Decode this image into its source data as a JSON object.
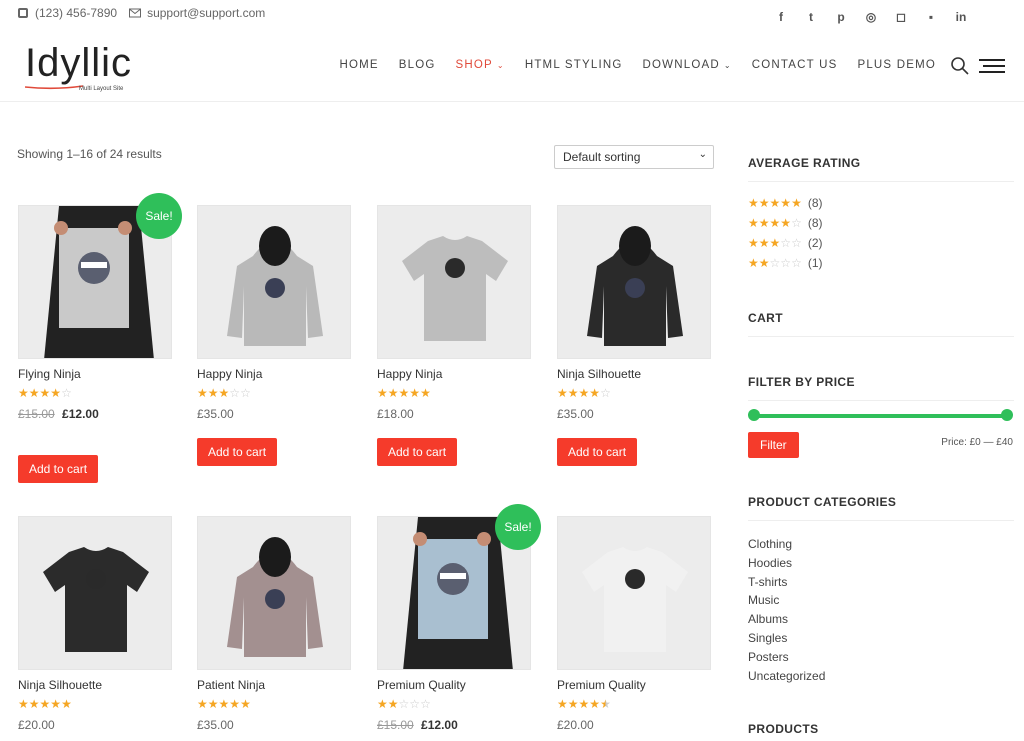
{
  "topbar": {
    "phone": "(123) 456-7890",
    "email": "support@support.com",
    "social": [
      "f",
      "t",
      "p",
      "d",
      "ig",
      "fl",
      "in"
    ]
  },
  "brand": {
    "name": "Idyllic",
    "tagline": "Multi Layout Site",
    "accent": "#e04a3a"
  },
  "nav": {
    "items": [
      "HOME",
      "BLOG",
      "SHOP",
      "HTML STYLING",
      "DOWNLOAD",
      "CONTACT US",
      "PLUS DEMO"
    ],
    "active": "SHOP"
  },
  "shop": {
    "results_text": "Showing 1–16 of 24 results",
    "sort_value": "Default sorting",
    "sale_label": "Sale!",
    "add_label": "Add to cart",
    "products": [
      {
        "name": "Flying Ninja",
        "rating": 4,
        "old_price": "£15.00",
        "price": "£12.00",
        "sale": true
      },
      {
        "name": "Happy Ninja",
        "rating": 3,
        "old_price": "",
        "price": "£35.00",
        "sale": false
      },
      {
        "name": "Happy Ninja",
        "rating": 5,
        "old_price": "",
        "price": "£18.00",
        "sale": false
      },
      {
        "name": "Ninja Silhouette",
        "rating": 4,
        "old_price": "",
        "price": "£35.00",
        "sale": false
      },
      {
        "name": "Ninja Silhouette",
        "rating": 5,
        "old_price": "",
        "price": "£20.00",
        "sale": false
      },
      {
        "name": "Patient Ninja",
        "rating": 5,
        "old_price": "",
        "price": "£35.00",
        "sale": false
      },
      {
        "name": "Premium Quality",
        "rating": 2,
        "old_price": "£15.00",
        "price": "£12.00",
        "sale": true
      },
      {
        "name": "Premium Quality",
        "rating": 4.5,
        "old_price": "",
        "price": "£20.00",
        "sale": false
      }
    ]
  },
  "sidebar": {
    "avg_rating_title": "AVERAGE RATING",
    "ratings": [
      {
        "stars": 5,
        "count": "(8)"
      },
      {
        "stars": 4,
        "count": "(8)"
      },
      {
        "stars": 3,
        "count": "(2)"
      },
      {
        "stars": 2,
        "count": "(1)"
      }
    ],
    "cart_title": "CART",
    "filter_title": "FILTER BY PRICE",
    "filter_button": "Filter",
    "price_label": "Price: £0 — £40",
    "categories_title": "PRODUCT CATEGORIES",
    "categories": [
      "Clothing",
      "Hoodies",
      "T-shirts",
      "Music",
      "Albums",
      "Singles",
      "Posters",
      "Uncategorized"
    ],
    "products_title": "PRODUCTS"
  }
}
